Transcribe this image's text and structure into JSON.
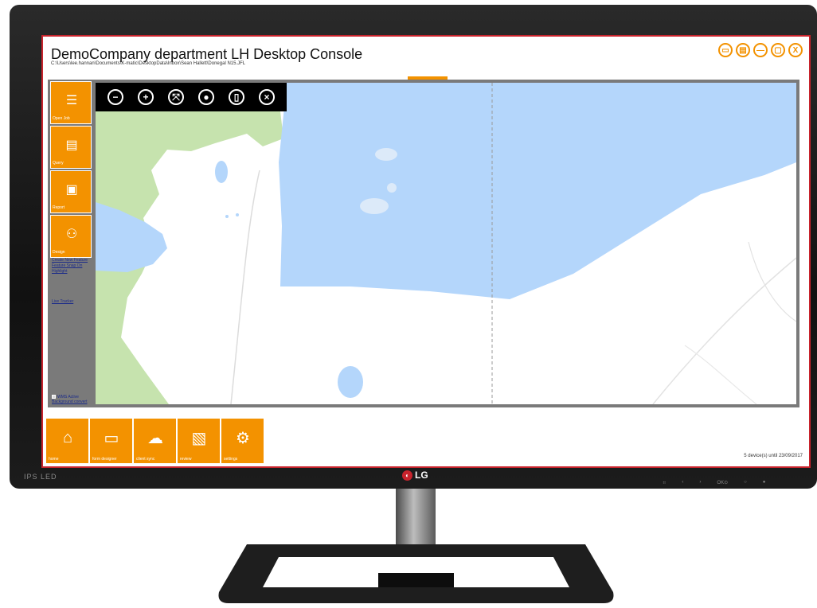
{
  "app": {
    "title": "DemoCompany department LH Desktop Console",
    "path": "C:\\Users\\lee.hannan\\Documents\\K-matic\\DesktopData\\Inbox\\Sean Hallett\\Donegal N15.JFL"
  },
  "window_controls": [
    {
      "name": "map-view-icon",
      "glyph": "▭"
    },
    {
      "name": "print-icon",
      "glyph": "▤"
    },
    {
      "name": "minimize-icon",
      "glyph": "—"
    },
    {
      "name": "maximize-icon",
      "glyph": "▢"
    },
    {
      "name": "close-icon",
      "glyph": "X"
    }
  ],
  "sidebar": {
    "buttons": [
      {
        "label": "Open Job",
        "glyph": "☰"
      },
      {
        "label": "Query",
        "glyph": "▤"
      },
      {
        "label": "Report",
        "glyph": "▣"
      },
      {
        "label": "Design",
        "glyph": "⚇"
      }
    ],
    "links": [
      "Create New Feature",
      "Feature Snap On",
      "Highlight",
      "Live Tracker"
    ],
    "check": {
      "line1": "WMS Active",
      "line2": "Background convert"
    }
  },
  "map_toolbar": [
    {
      "name": "zoom-out-icon",
      "glyph": "−"
    },
    {
      "name": "zoom-in-icon",
      "glyph": "+"
    },
    {
      "name": "zoom-extent-icon",
      "glyph": "⤧"
    },
    {
      "name": "locate-icon",
      "glyph": "●"
    },
    {
      "name": "layers-icon",
      "glyph": "▯"
    },
    {
      "name": "clear-icon",
      "glyph": "×"
    }
  ],
  "bottom_bar": {
    "buttons": [
      {
        "label": "home",
        "glyph": "⌂"
      },
      {
        "label": "form designer",
        "glyph": "▭"
      },
      {
        "label": "client sync",
        "glyph": "☁"
      },
      {
        "label": "review",
        "glyph": "▧"
      },
      {
        "label": "settings",
        "glyph": "⚙"
      }
    ],
    "license": "5 device(s) until 23/09/2017"
  },
  "bezel": {
    "left_brand": "IPS LED",
    "logo": "LG",
    "controls": [
      "⠶",
      "‹",
      "›",
      "OK⊙",
      "○",
      "●"
    ]
  },
  "colors": {
    "accent": "#f39200",
    "frame": "#c8232c",
    "water": "#b4d6fb",
    "green": "#c6e3ae"
  }
}
